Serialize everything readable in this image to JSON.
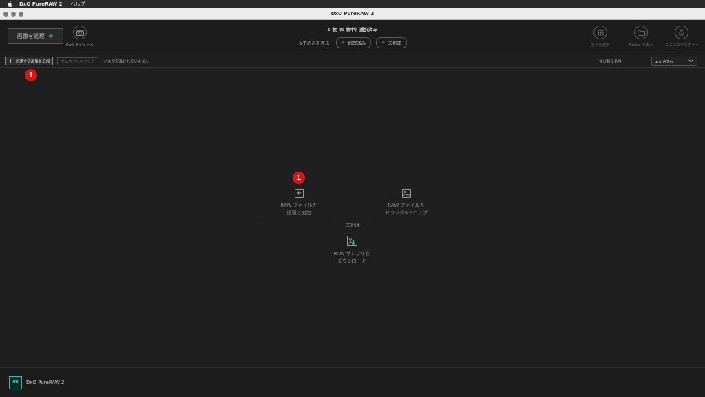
{
  "menubar": {
    "app_name": "DxO PureRAW 2",
    "help": "ヘルプ"
  },
  "window": {
    "title": "DxO PureRAW 2"
  },
  "toolbar": {
    "process_label": "画像を処理",
    "process_plus": "+",
    "module_label": "DxO モジュール",
    "selection_status": "0 枚（0 枚中）選択済み",
    "filter_label": "以下のみを表示:",
    "filter_processed": "処理済み",
    "filter_unprocessed": "未処理",
    "select_all": "全てを選択",
    "show_finder": "Finder で表示",
    "export_here": "ここにエクスポート"
  },
  "subbar": {
    "add_label": "処理する画像を追加",
    "clear_label": "サムネイルをクリア",
    "path_status": "パスが定義されていません",
    "sort_label": "並び替え条件",
    "sort_value": "AからZへ"
  },
  "badges": {
    "top": "1",
    "center": "1"
  },
  "empty_state": {
    "add_raw_line1": "RAW ファイルを",
    "add_raw_line2": "処理に追加",
    "drag_line1": "RAW ファイルを",
    "drag_line2": "ドラッグ&ドロップ",
    "or": "または",
    "sample_line1": "RAW サンプルを",
    "sample_line2": "ダウンロード"
  },
  "footer": {
    "logo_text": "PR",
    "brand": "DxO PureRAW 2"
  },
  "colors": {
    "accent": "#2ac0a9",
    "badge": "#d01a1a"
  }
}
